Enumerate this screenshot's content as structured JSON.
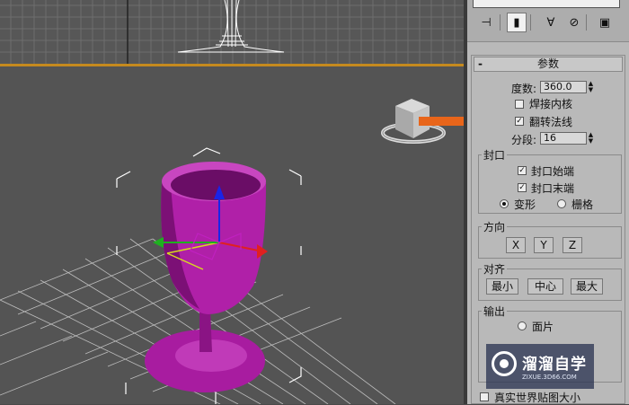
{
  "toolbar": {
    "tabs": [
      {
        "icon": "pin-icon"
      },
      {
        "icon": "modifier-stack-icon",
        "active": true
      },
      {
        "icon": "show-end-result-icon"
      },
      {
        "icon": "make-unique-icon"
      },
      {
        "icon": "configure-sets-icon"
      }
    ]
  },
  "rollout": {
    "toggle": "-",
    "title": "参数"
  },
  "degrees": {
    "label": "度数:",
    "value": "360.0"
  },
  "weld_core": {
    "label": "焊接内核",
    "checked": false
  },
  "flip_normals": {
    "label": "翻转法线",
    "checked": true
  },
  "segments": {
    "label": "分段:",
    "value": "16"
  },
  "capping": {
    "title": "封口",
    "cap_start": {
      "label": "封口始端",
      "checked": true
    },
    "cap_end": {
      "label": "封口末端",
      "checked": true
    },
    "morph": {
      "label": "变形",
      "selected": true
    },
    "grid": {
      "label": "栅格",
      "selected": false
    }
  },
  "direction": {
    "title": "方向",
    "x": "X",
    "y": "Y",
    "z": "Z"
  },
  "align": {
    "title": "对齐",
    "min": "最小",
    "center": "中心",
    "max": "最大"
  },
  "output": {
    "title": "输出",
    "patch": {
      "label": "面片",
      "selected": false
    }
  },
  "real_world_map": {
    "label": "真实世界贴图大小",
    "checked": false
  },
  "watermark": {
    "title": "溜溜自学",
    "subtitle": "ZIXUE.3D66.COM"
  },
  "colors": {
    "goblet": "#b020a8",
    "arrow": "#e8651a",
    "viewport_border": "#c58a1e"
  }
}
